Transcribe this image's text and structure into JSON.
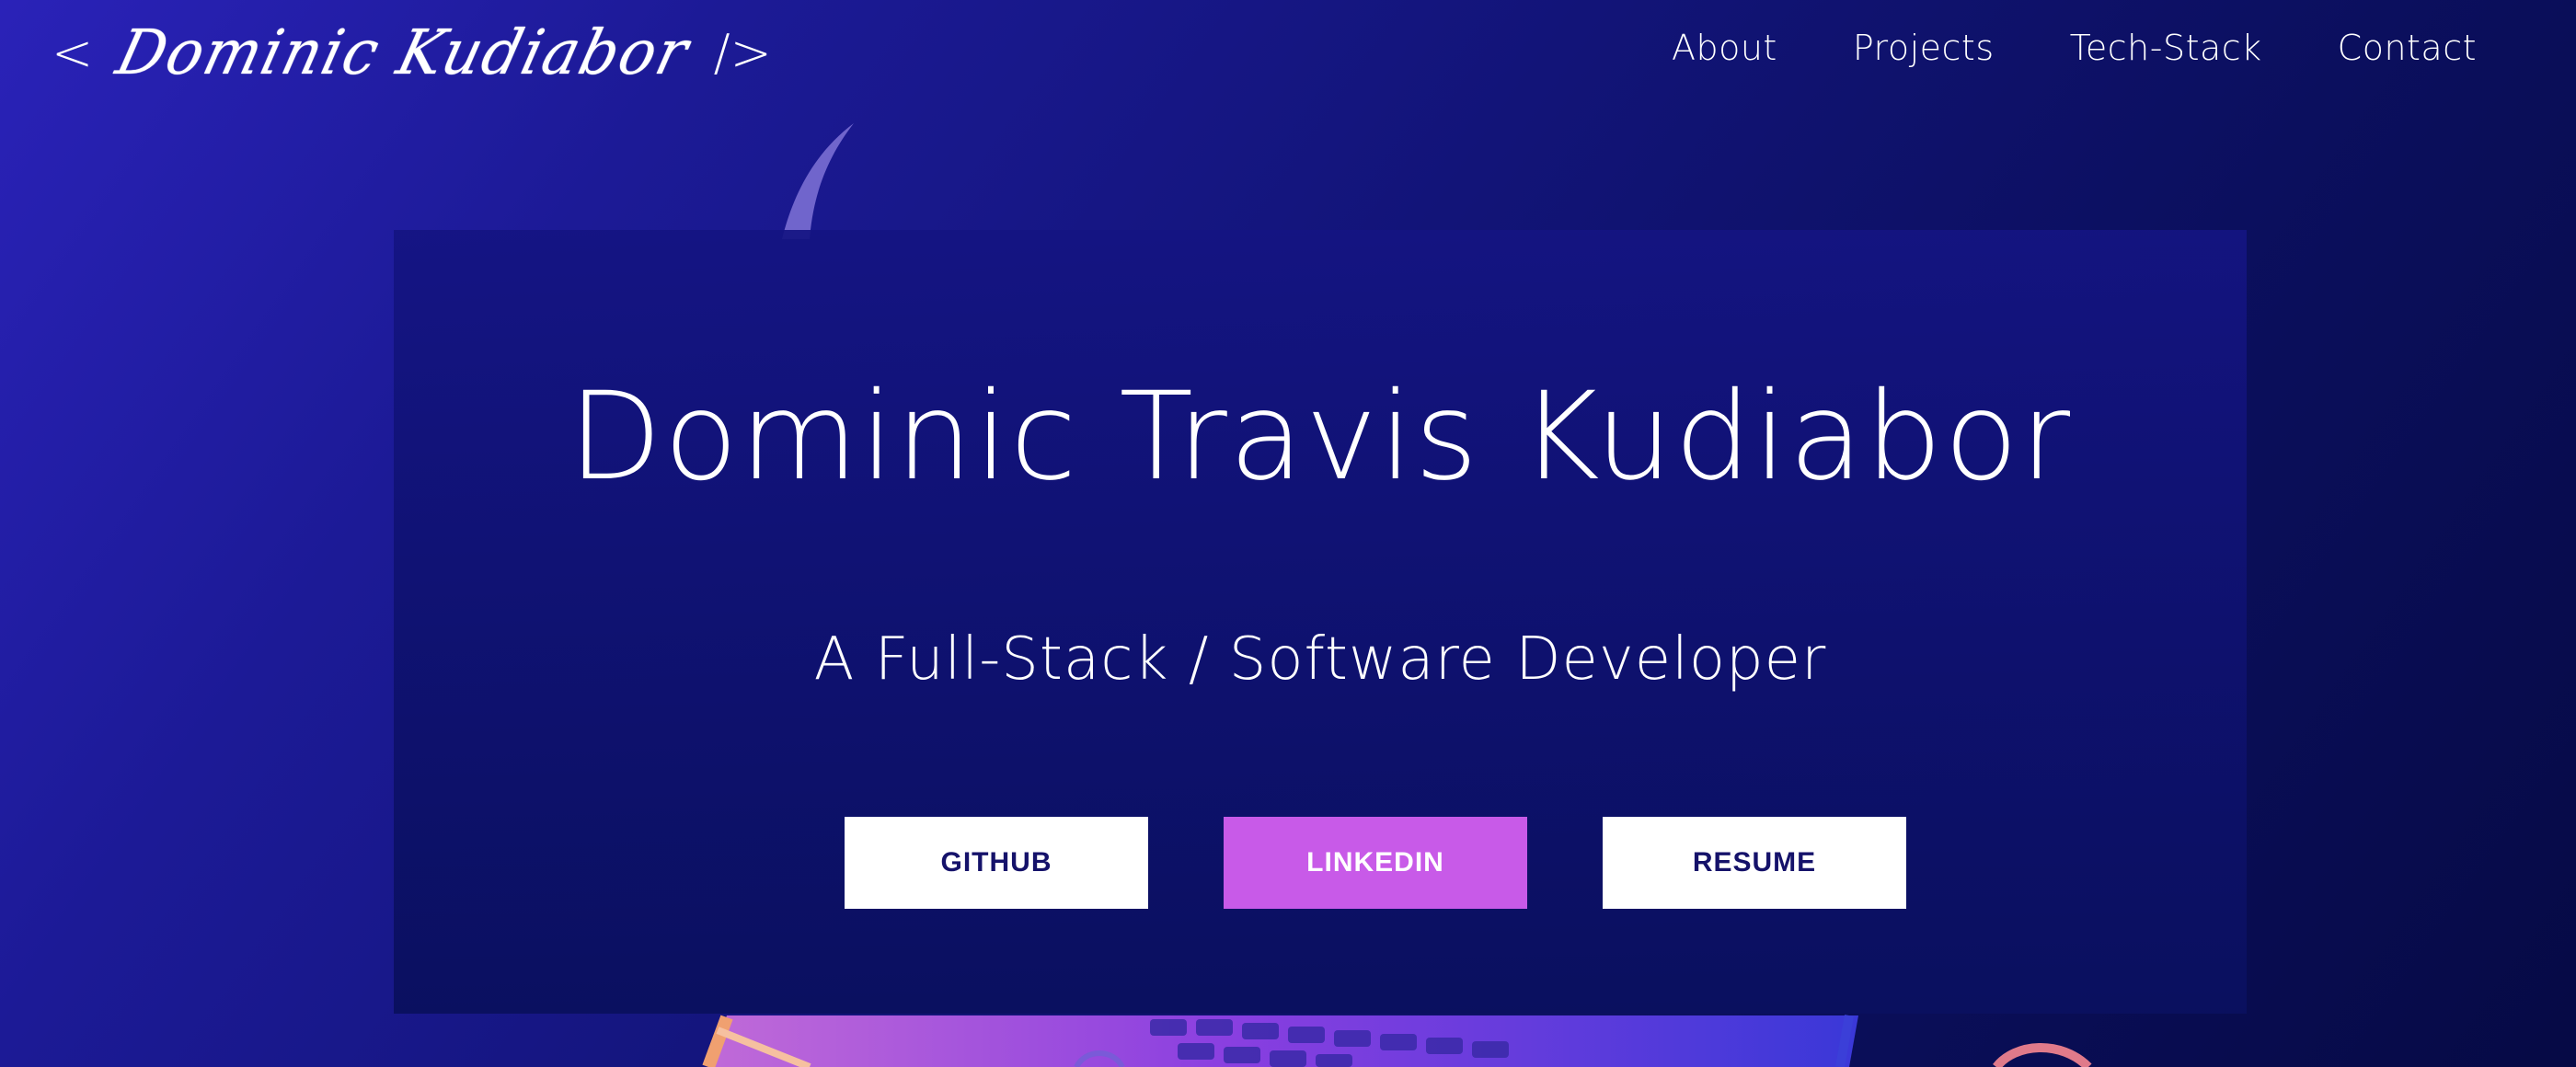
{
  "nav": {
    "logo_open": "<",
    "logo_name": "Dominic Kudiabor",
    "logo_close": "/>",
    "links": [
      {
        "label": "About"
      },
      {
        "label": "Projects"
      },
      {
        "label": "Tech-Stack"
      },
      {
        "label": "Contact"
      }
    ]
  },
  "hero": {
    "name": "Dominic Travis Kudiabor",
    "subtitle": "A Full-Stack / Software Developer",
    "buttons": [
      {
        "label": "GITHUB",
        "style": "light"
      },
      {
        "label": "LINKEDIN",
        "style": "accent"
      },
      {
        "label": "RESUME",
        "style": "light"
      }
    ]
  },
  "colors": {
    "background_start": "#2a22b8",
    "background_end": "#060a45",
    "card": "#14148a",
    "accent": "#c85ae8",
    "button_text_dark": "#15126a"
  }
}
